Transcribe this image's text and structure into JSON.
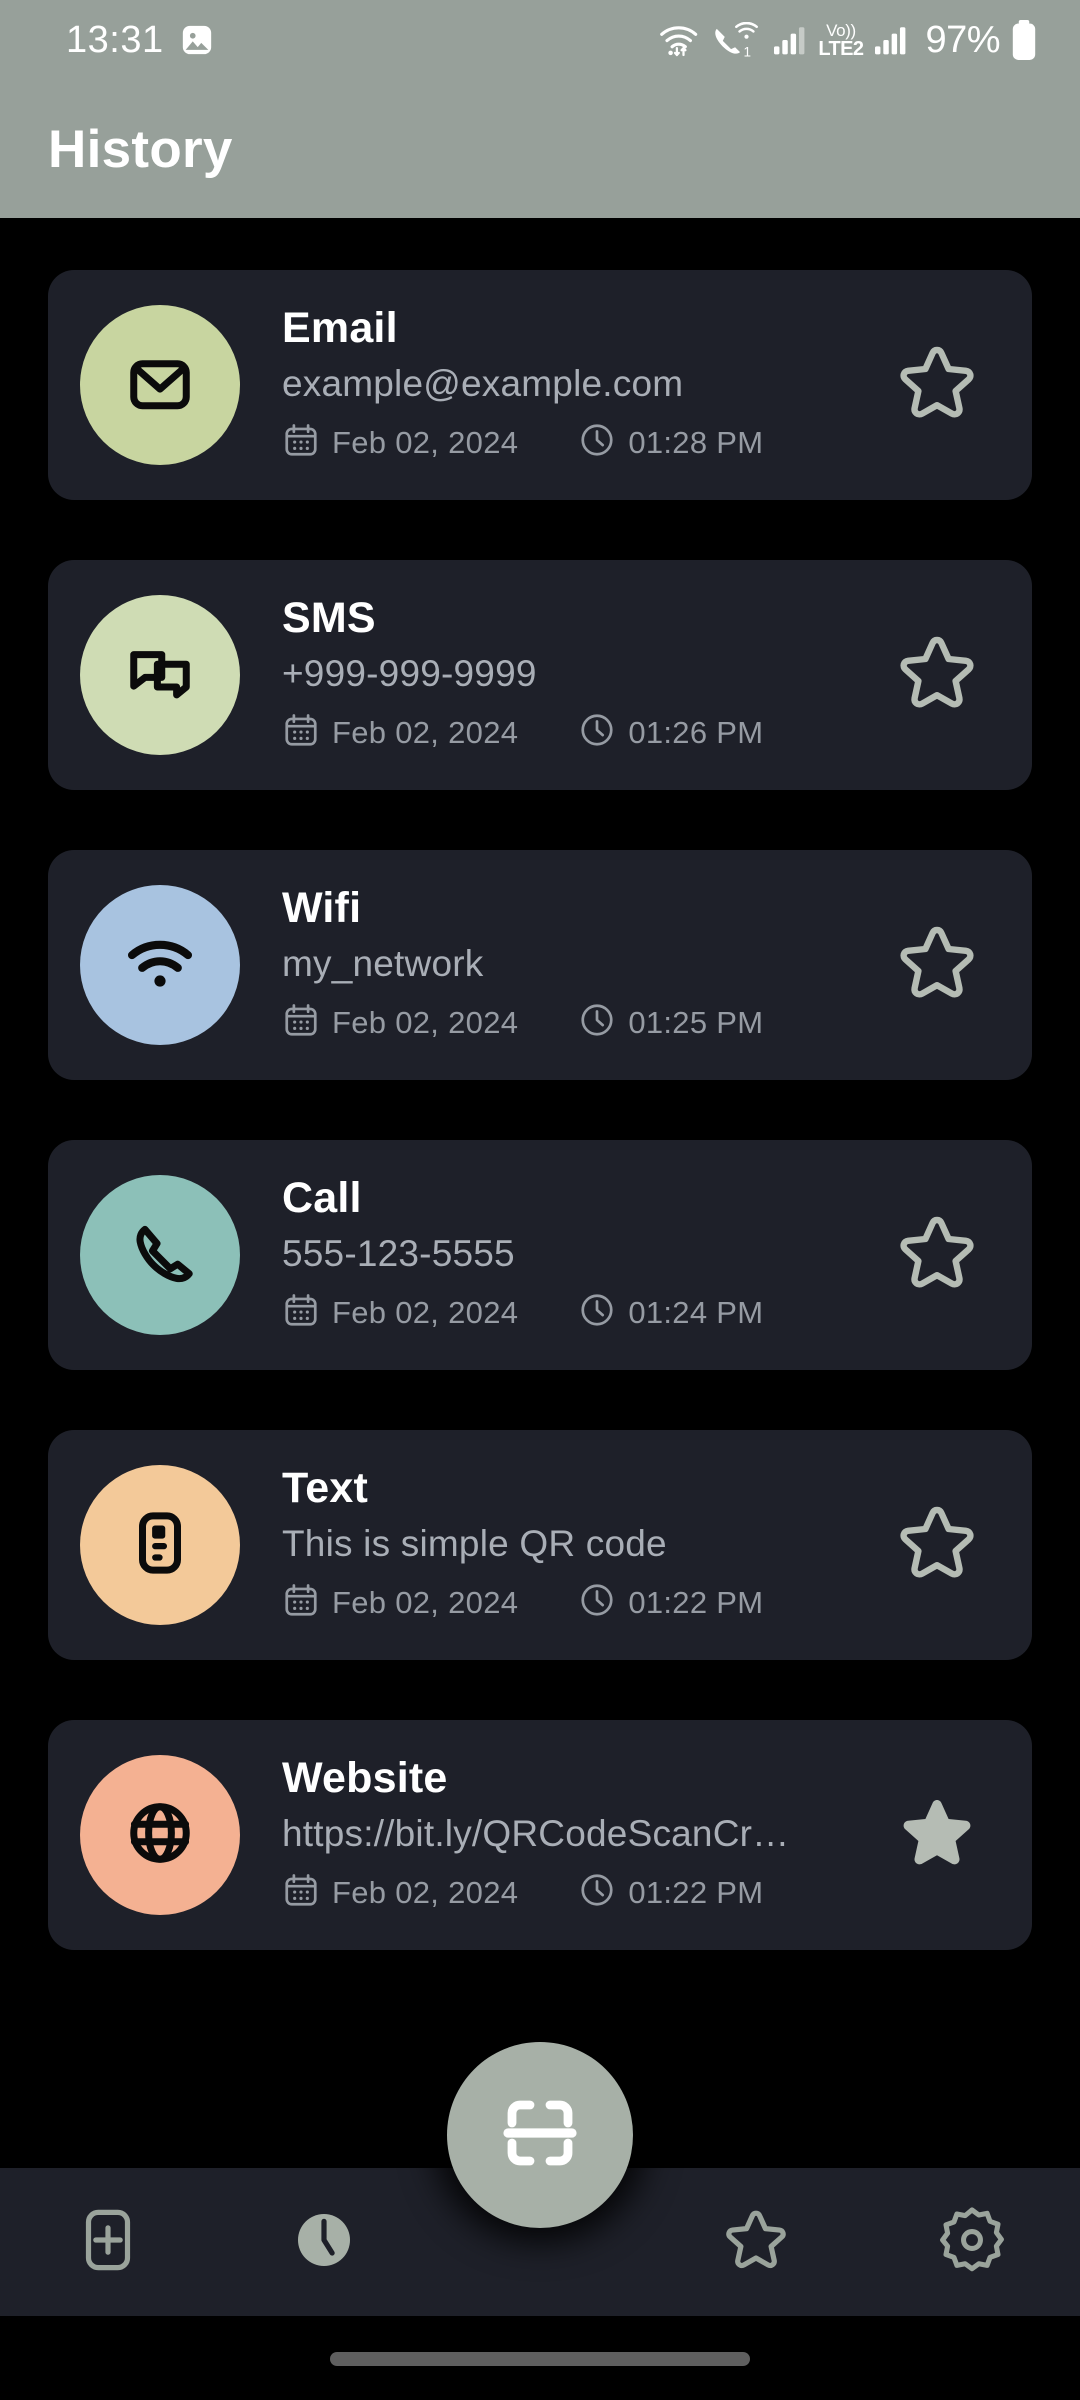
{
  "status_bar": {
    "time": "13:31",
    "icons": [
      "image-icon",
      "wifi-icon",
      "wifi-calling-icon",
      "signal-bars-1-icon",
      "volte-lte2-icon",
      "signal-bars-2-icon",
      "battery-icon"
    ],
    "sim1_label": "1",
    "volte_top": "Vo))",
    "volte_bottom": "LTE2",
    "battery_percent": "97%"
  },
  "app_bar": {
    "title": "History",
    "background": "#97a09a"
  },
  "theme": {
    "page_background": "#000000",
    "card_background": "#1e2029",
    "accent": "#a7b0a7",
    "title_color": "#ffffff",
    "subtitle_color": "#a9aeb6",
    "meta_color": "#969ba3"
  },
  "history": {
    "meta_icons": {
      "date": "calendar-icon",
      "time": "clock-icon"
    },
    "items": [
      {
        "type": "Email",
        "icon": "envelope-icon",
        "avatar_color": "#c8d5a0",
        "value": "example@example.com",
        "date": "Feb 02, 2024",
        "time": "01:28 PM",
        "favorite": false,
        "star_icon": "star-outline-icon"
      },
      {
        "type": "SMS",
        "icon": "chat-bubbles-icon",
        "avatar_color": "#cfdcb4",
        "value": "+999-999-9999",
        "date": "Feb 02, 2024",
        "time": "01:26 PM",
        "favorite": false,
        "star_icon": "star-outline-icon"
      },
      {
        "type": "Wifi",
        "icon": "wifi-icon",
        "avatar_color": "#a8c3e0",
        "value": "my_network",
        "date": "Feb 02, 2024",
        "time": "01:25 PM",
        "favorite": false,
        "star_icon": "star-outline-icon"
      },
      {
        "type": "Call",
        "icon": "phone-icon",
        "avatar_color": "#8cc0b8",
        "value": "555-123-5555",
        "date": "Feb 02, 2024",
        "time": "01:24 PM",
        "favorite": false,
        "star_icon": "star-outline-icon"
      },
      {
        "type": "Text",
        "icon": "document-icon",
        "avatar_color": "#f3c999",
        "value": "This is simple QR code",
        "date": "Feb 02, 2024",
        "time": "01:22 PM",
        "favorite": false,
        "star_icon": "star-outline-icon"
      },
      {
        "type": "Website",
        "icon": "globe-icon",
        "avatar_color": "#f4b192",
        "value": "https://bit.ly/QRCodeScanCr…",
        "date": "Feb 02, 2024",
        "time": "01:22 PM",
        "favorite": true,
        "star_icon": "star-filled-icon"
      }
    ]
  },
  "bottom_nav": {
    "items": [
      {
        "name": "create",
        "icon": "plus-square-icon",
        "active": false
      },
      {
        "name": "history",
        "icon": "clock-filled-icon",
        "active": true
      },
      {
        "name": "favorites",
        "icon": "star-outline-icon",
        "active": false
      },
      {
        "name": "settings",
        "icon": "gear-icon",
        "active": false
      }
    ],
    "fab": {
      "name": "scan",
      "icon": "scan-frame-icon",
      "color": "#a7b0a7"
    }
  }
}
